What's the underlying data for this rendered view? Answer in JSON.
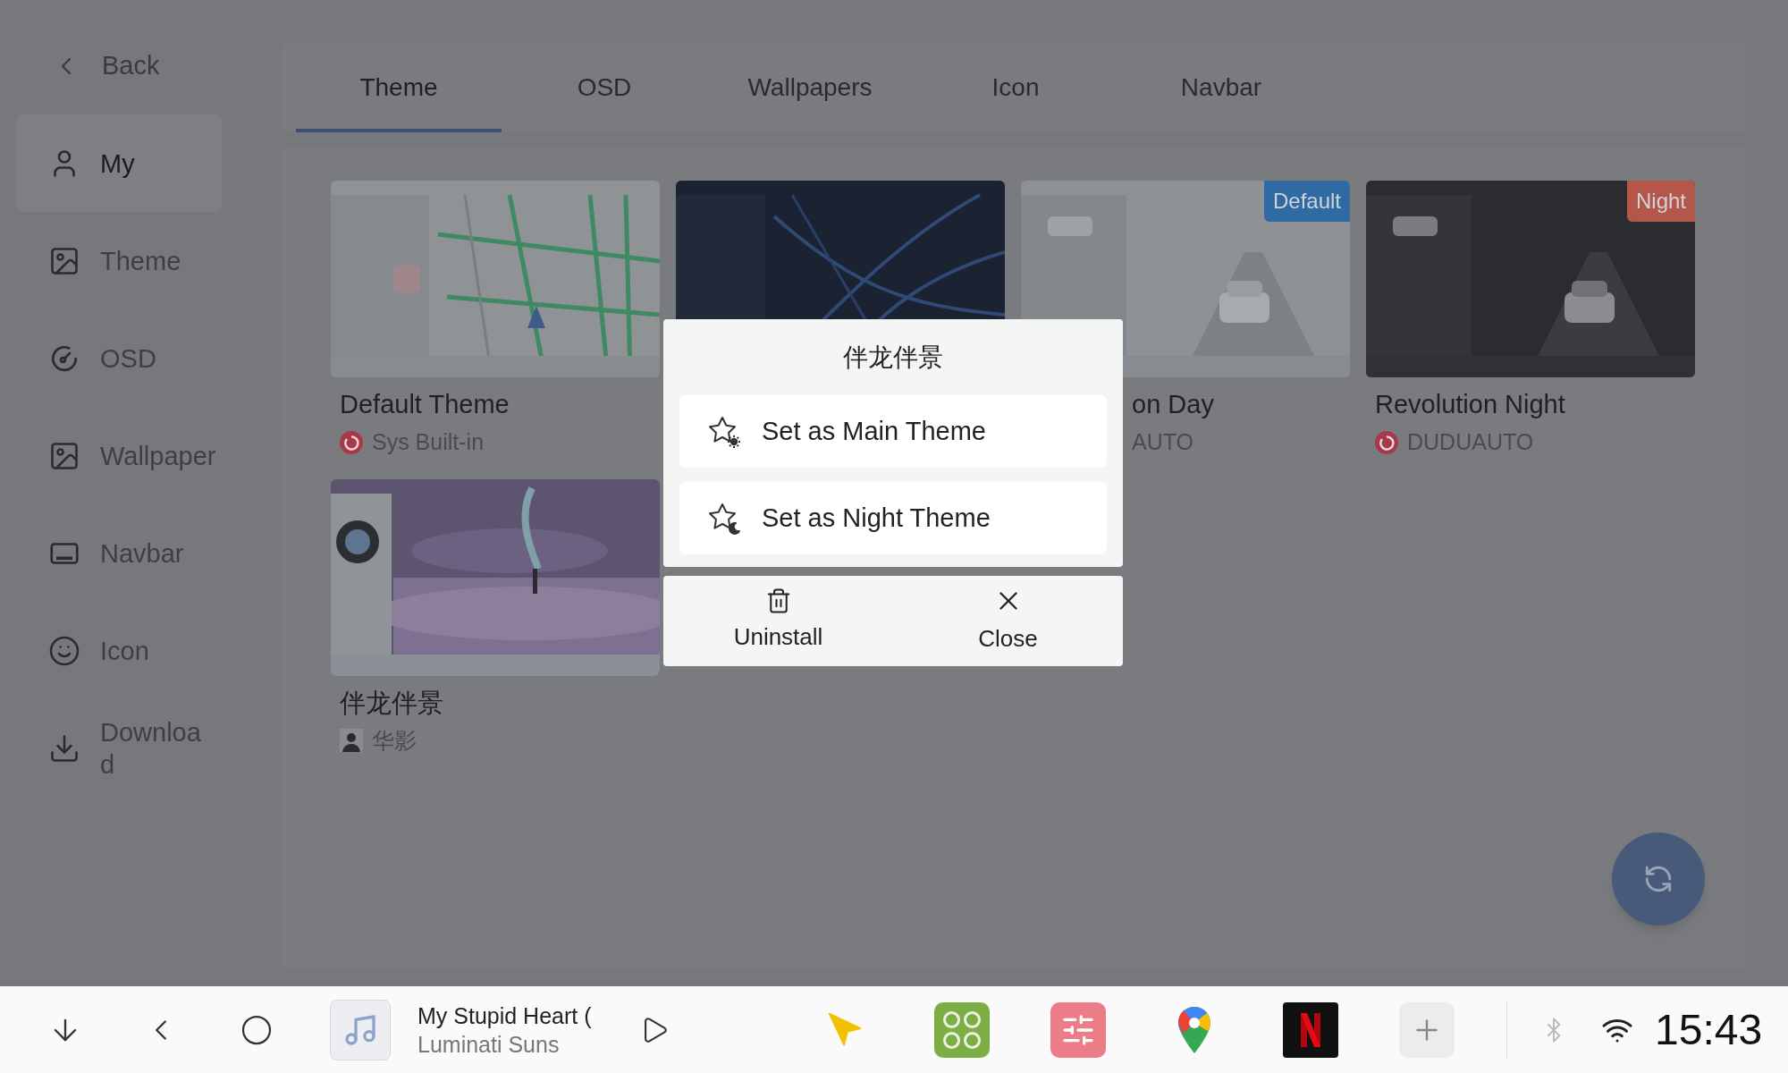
{
  "sidebar": {
    "back": "Back",
    "items": [
      {
        "label": "My",
        "selected": true
      },
      {
        "label": "Theme",
        "selected": false
      },
      {
        "label": "OSD",
        "selected": false
      },
      {
        "label": "Wallpaper",
        "selected": false
      },
      {
        "label": "Navbar",
        "selected": false
      },
      {
        "label": "Icon",
        "selected": false
      },
      {
        "label": "Download",
        "selected": false
      }
    ]
  },
  "tabs": [
    {
      "label": "Theme",
      "selected": true
    },
    {
      "label": "OSD",
      "selected": false
    },
    {
      "label": "Wallpapers",
      "selected": false
    },
    {
      "label": "Icon",
      "selected": false
    },
    {
      "label": "Navbar",
      "selected": false
    }
  ],
  "themes": [
    {
      "title": "Default Theme",
      "author": "Sys Built-in",
      "covered": false
    },
    {
      "kind": "picture"
    },
    {
      "title": "on Day",
      "author": "AUTO",
      "badge": {
        "text": "Default",
        "color": "#2f6aa3"
      },
      "covered": true
    },
    {
      "title": "Revolution Night",
      "author": "DUDUAUTO",
      "badge": {
        "text": "Night",
        "color": "#b4574a"
      },
      "covered": false
    },
    {
      "title": "伴龙伴景",
      "author": "华影",
      "covered": false
    }
  ],
  "dialog": {
    "title": "伴龙伴景",
    "options": [
      {
        "label": "Set as Main Theme",
        "kind": "main"
      },
      {
        "label": "Set as Night Theme",
        "kind": "night"
      }
    ],
    "actions": [
      {
        "label": "Uninstall",
        "kind": "uninstall"
      },
      {
        "label": "Close",
        "kind": "close"
      }
    ]
  },
  "navbar": {
    "song_title": "My Stupid Heart (",
    "song_artist": "Luminati Suns",
    "time": "15:43"
  }
}
